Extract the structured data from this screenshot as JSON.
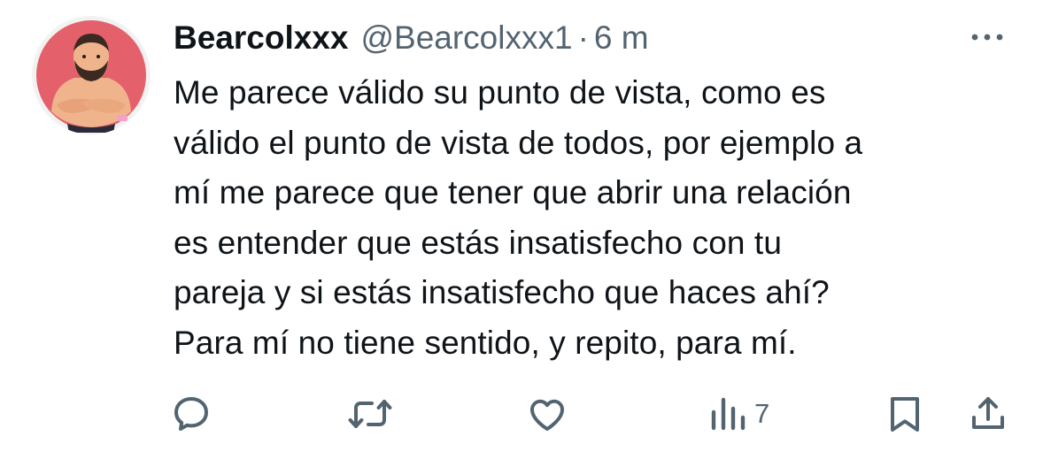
{
  "tweet": {
    "author_name": "Bearcolxxx",
    "author_handle": "@Bearcolxxx1",
    "separator": "·",
    "time": "6 m",
    "text_lines": [
      "Me parece válido su punto de vista, como es",
      "válido el punto de vista de todos, por ejemplo a",
      "mí me parece que tener que abrir una relación",
      "es entender que estás insatisfecho con tu",
      "pareja y si estás insatisfecho que haces ahí?",
      "Para mí no tiene sentido, y repito, para mí."
    ],
    "views_count": "7"
  },
  "icons": {
    "more": "more-horizontal-icon",
    "reply": "reply-icon",
    "retweet": "retweet-icon",
    "like": "heart-icon",
    "views": "views-chart-icon",
    "bookmark": "bookmark-icon",
    "share": "share-icon"
  },
  "colors": {
    "text_primary": "#0f1419",
    "text_secondary": "#536471",
    "avatar_background": "#e4606b"
  }
}
